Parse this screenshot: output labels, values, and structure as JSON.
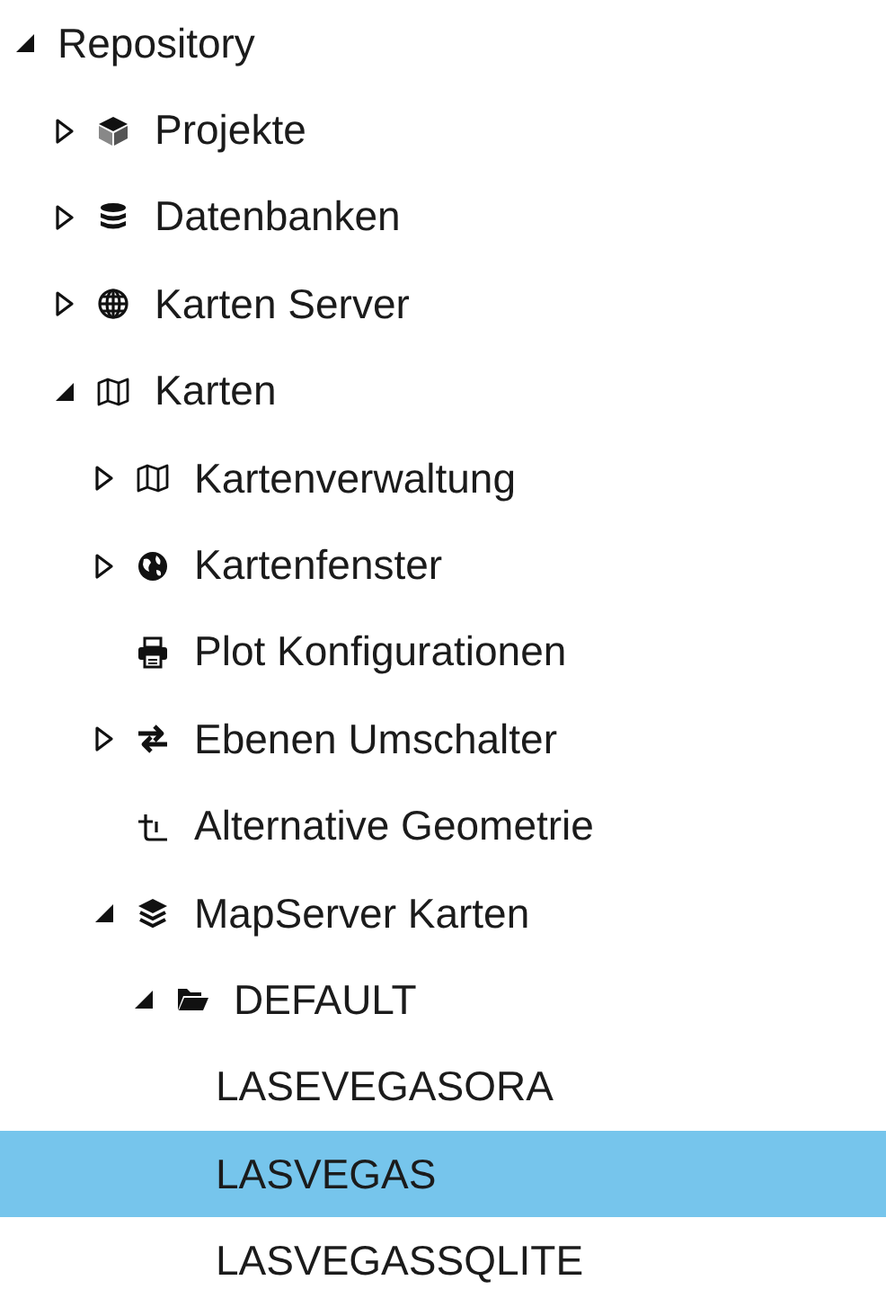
{
  "tree": [
    {
      "label": "Repository",
      "expanded": true,
      "selected": false,
      "children": [
        {
          "label": "Projekte",
          "kind": "cube",
          "expanded": false,
          "selected": false
        },
        {
          "label": "Datenbanken",
          "kind": "database",
          "expanded": false,
          "selected": false
        },
        {
          "label": "Karten Server",
          "kind": "globe",
          "expanded": false,
          "selected": false
        },
        {
          "label": "Karten",
          "kind": "map",
          "expanded": true,
          "selected": false,
          "children": [
            {
              "label": "Kartenverwaltung",
              "kind": "map",
              "expanded": false,
              "selected": false
            },
            {
              "label": "Kartenfenster",
              "kind": "earth",
              "expanded": false,
              "selected": false
            },
            {
              "label": "Plot Konfigurationen",
              "kind": "printer",
              "selected": false
            },
            {
              "label": "Ebenen Umschalter",
              "kind": "swap",
              "expanded": false,
              "selected": false
            },
            {
              "label": "Alternative Geometrie",
              "kind": "geometry",
              "selected": false
            },
            {
              "label": "MapServer Karten",
              "kind": "layers",
              "expanded": true,
              "selected": false,
              "children": [
                {
                  "label": "DEFAULT",
                  "kind": "folder",
                  "expanded": true,
                  "selected": false,
                  "children": [
                    {
                      "label": "LASEVEGASORA",
                      "selected": false
                    },
                    {
                      "label": "LASVEGAS",
                      "selected": true
                    },
                    {
                      "label": "LASVEGASSQLITE",
                      "selected": false
                    }
                  ]
                }
              ]
            }
          ]
        }
      ]
    }
  ]
}
